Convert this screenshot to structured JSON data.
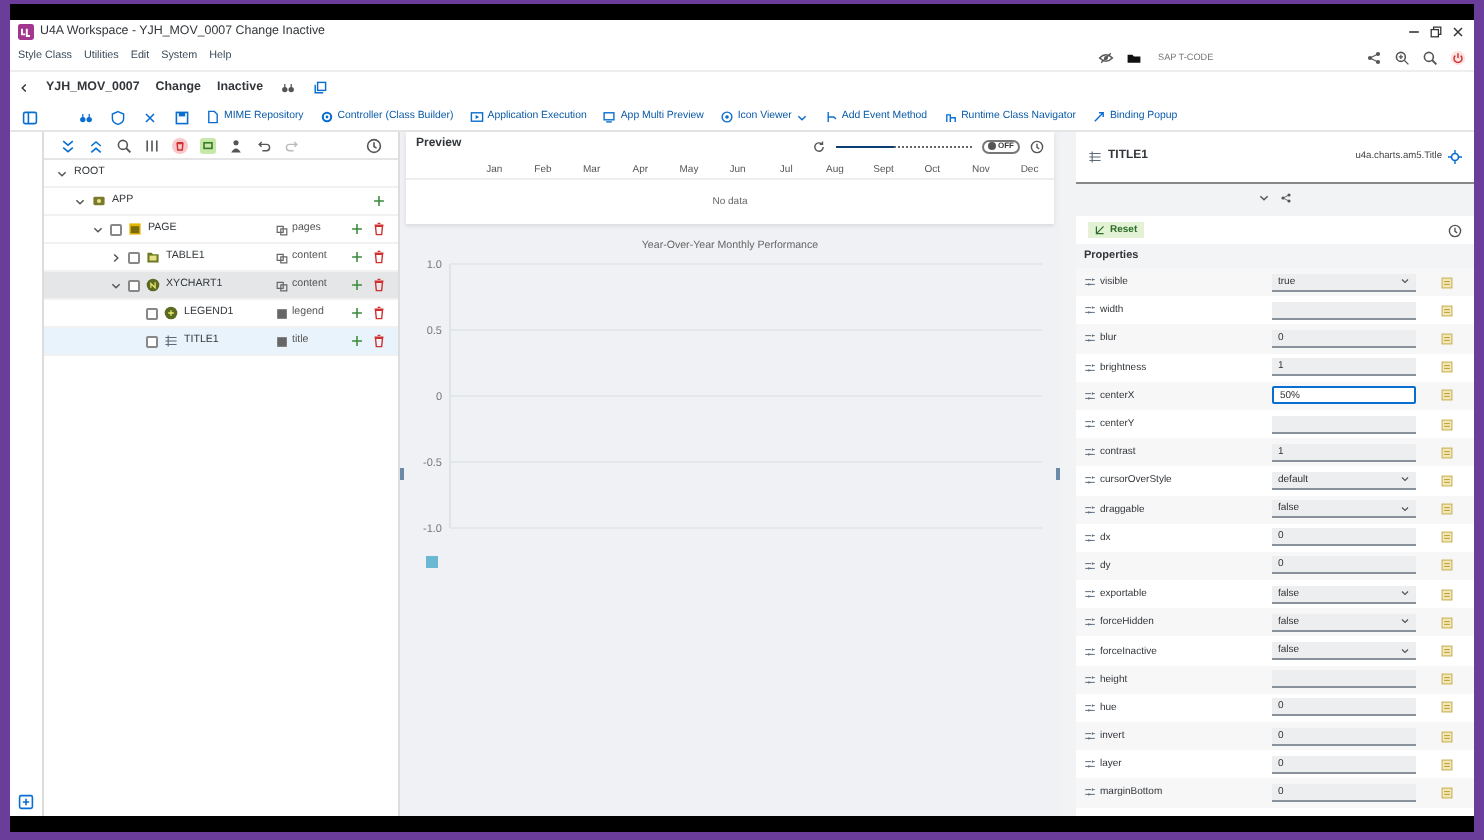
{
  "window": {
    "title": "U4A Workspace - YJH_MOV_0007 Change Inactive"
  },
  "menu": [
    {
      "label": "Style Class"
    },
    {
      "label": "Utilities"
    },
    {
      "label": "Edit"
    },
    {
      "label": "System"
    },
    {
      "label": "Help"
    }
  ],
  "tcode": {
    "placeholder": "SAP T-CODE"
  },
  "header": {
    "program": "YJH_MOV_0007",
    "mode": "Change",
    "status": "Inactive"
  },
  "toolbar": [
    {
      "label": "MIME Repository",
      "dropdown": false
    },
    {
      "label": "Controller (Class Builder)",
      "dropdown": false
    },
    {
      "label": "Application Execution",
      "dropdown": false
    },
    {
      "label": "App Multi Preview",
      "dropdown": false
    },
    {
      "label": "Icon Viewer",
      "dropdown": true
    },
    {
      "label": "Add Event Method",
      "dropdown": false
    },
    {
      "label": "Runtime Class Navigator",
      "dropdown": false
    },
    {
      "label": "Binding Popup",
      "dropdown": false
    }
  ],
  "tree": [
    {
      "name": "ROOT",
      "expanded": true,
      "checkbox": false,
      "add": false,
      "delete": false,
      "selected": false,
      "highlighted": false,
      "children": [
        {
          "name": "APP",
          "kind": "app",
          "expanded": true,
          "checkbox": false,
          "add": true,
          "delete": false,
          "selected": false,
          "highlighted": false,
          "children": [
            {
              "name": "PAGE",
              "kind": "page",
              "aggregation": "pages",
              "expanded": true,
              "checkbox": true,
              "add": true,
              "delete": true,
              "selected": false,
              "highlighted": false,
              "children": [
                {
                  "name": "TABLE1",
                  "kind": "table",
                  "aggregation": "content",
                  "expanded": false,
                  "checkbox": true,
                  "add": true,
                  "delete": true,
                  "selected": false,
                  "highlighted": false
                },
                {
                  "name": "XYCHART1",
                  "kind": "chart",
                  "aggregation": "content",
                  "expanded": true,
                  "checkbox": true,
                  "add": true,
                  "delete": true,
                  "selected": true,
                  "highlighted": false,
                  "children": [
                    {
                      "name": "LEGEND1",
                      "kind": "legend",
                      "aggregation": "legend",
                      "checkbox": true,
                      "add": true,
                      "delete": true,
                      "selected": false,
                      "highlighted": false
                    },
                    {
                      "name": "TITLE1",
                      "kind": "title",
                      "aggregation": "title",
                      "checkbox": true,
                      "add": true,
                      "delete": true,
                      "selected": false,
                      "highlighted": true
                    }
                  ]
                }
              ]
            }
          ]
        }
      ]
    }
  ],
  "preview": {
    "title": "Preview",
    "slider": {
      "level": 0.42
    },
    "toggle": {
      "label": "OFF",
      "on": false
    },
    "months": [
      "Jan",
      "Feb",
      "Mar",
      "Apr",
      "May",
      "Jun",
      "Jul",
      "Aug",
      "Sept",
      "Oct",
      "Nov",
      "Dec"
    ],
    "empty_text": "No data",
    "chart": {
      "title": "Year-Over-Year Monthly Performance",
      "y_labels": [
        "1.0",
        "0.5",
        "0",
        "-0.5",
        "-1.0"
      ]
    }
  },
  "inspector": {
    "title": "TITLE1",
    "class": "u4a.charts.am5.Title",
    "reset": "Reset",
    "section": "Properties",
    "properties": [
      {
        "name": "visible",
        "kind": "select",
        "value": "true",
        "focused": false
      },
      {
        "name": "width",
        "kind": "input",
        "focused": false
      },
      {
        "name": "blur",
        "kind": "input",
        "value": "0",
        "focused": false
      },
      {
        "name": "brightness",
        "kind": "input",
        "value": "1",
        "focused": false
      },
      {
        "name": "centerX",
        "kind": "input",
        "value": "50%",
        "focused": true
      },
      {
        "name": "centerY",
        "kind": "input",
        "focused": false
      },
      {
        "name": "contrast",
        "kind": "input",
        "value": "1",
        "focused": false
      },
      {
        "name": "cursorOverStyle",
        "kind": "select",
        "value": "default",
        "focused": false
      },
      {
        "name": "draggable",
        "kind": "select",
        "value": "false",
        "focused": false
      },
      {
        "name": "dx",
        "kind": "input",
        "value": "0",
        "focused": false
      },
      {
        "name": "dy",
        "kind": "input",
        "value": "0",
        "focused": false
      },
      {
        "name": "exportable",
        "kind": "select",
        "value": "false",
        "focused": false
      },
      {
        "name": "forceHidden",
        "kind": "select",
        "value": "false",
        "focused": false
      },
      {
        "name": "forceInactive",
        "kind": "select",
        "value": "false",
        "focused": false
      },
      {
        "name": "height",
        "kind": "input",
        "focused": false
      },
      {
        "name": "hue",
        "kind": "input",
        "value": "0",
        "focused": false
      },
      {
        "name": "invert",
        "kind": "input",
        "value": "0",
        "focused": false
      },
      {
        "name": "layer",
        "kind": "input",
        "value": "0",
        "focused": false
      },
      {
        "name": "marginBottom",
        "kind": "input",
        "value": "0",
        "focused": false
      }
    ]
  }
}
